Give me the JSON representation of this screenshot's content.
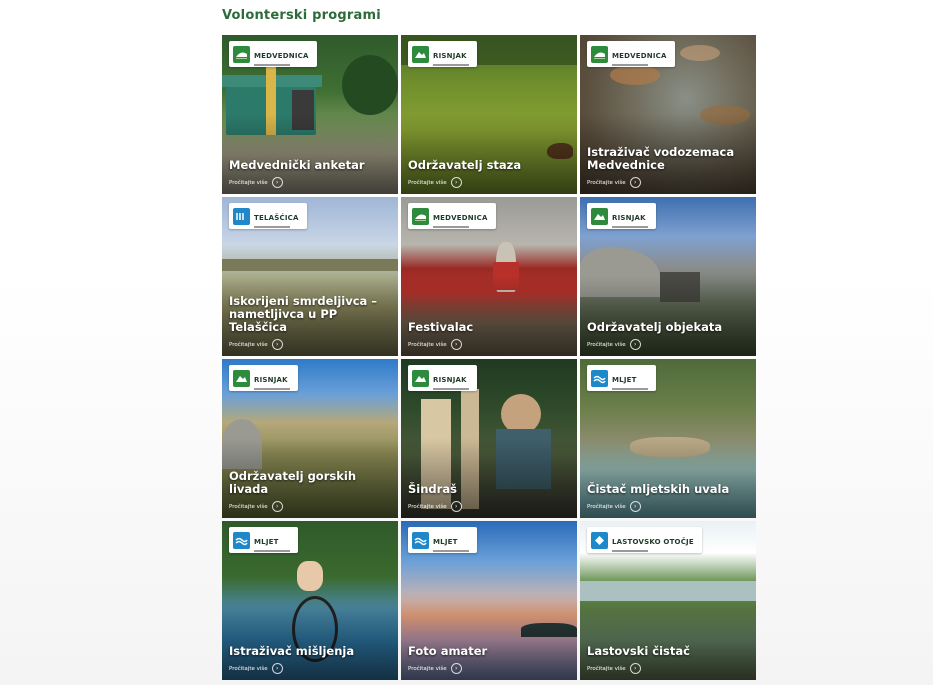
{
  "page": {
    "title": "Volonterski programi"
  },
  "read_more_label": "Pročitajte više",
  "cards": [
    {
      "title": "Medvednički anketar",
      "logo": "MEDVEDNICA",
      "logo_icon": "medvednica-logo-icon",
      "logo_color": "#2e8b3d"
    },
    {
      "title": "Održavatelj staza",
      "logo": "RISNJAK",
      "logo_icon": "risnjak-logo-icon",
      "logo_color": "#2e8b3d"
    },
    {
      "title": "Istraživač vodozemaca Medvednice",
      "logo": "MEDVEDNICA",
      "logo_icon": "medvednica-logo-icon",
      "logo_color": "#2e8b3d"
    },
    {
      "title": "Iskorijeni smrdeljivca – nametljivca u PP Telaščica",
      "logo": "TELAŠĆICA",
      "logo_icon": "telascica-logo-icon",
      "logo_color": "#1e88c8"
    },
    {
      "title": "Festivalac",
      "logo": "MEDVEDNICA",
      "logo_icon": "medvednica-logo-icon",
      "logo_color": "#2e8b3d"
    },
    {
      "title": "Održavatelj objekata",
      "logo": "RISNJAK",
      "logo_icon": "risnjak-logo-icon",
      "logo_color": "#2e8b3d"
    },
    {
      "title": "Održavatelj gorskih livada",
      "logo": "RISNJAK",
      "logo_icon": "risnjak-logo-icon",
      "logo_color": "#2e8b3d"
    },
    {
      "title": "Šindraš",
      "logo": "RISNJAK",
      "logo_icon": "risnjak-logo-icon",
      "logo_color": "#2e8b3d"
    },
    {
      "title": "Čistač mljetskih uvala",
      "logo": "MLJET",
      "logo_icon": "mljet-logo-icon",
      "logo_color": "#1e88c8"
    },
    {
      "title": "Istraživač mišljenja",
      "logo": "MLJET",
      "logo_icon": "mljet-logo-icon",
      "logo_color": "#1e88c8"
    },
    {
      "title": "Foto amater",
      "logo": "MLJET",
      "logo_icon": "mljet-logo-icon",
      "logo_color": "#1e88c8"
    },
    {
      "title": "Lastovski čistač",
      "logo": "LASTOVSKO OTOČJE",
      "logo_icon": "lastovo-logo-icon",
      "logo_color": "#1e88c8"
    }
  ]
}
